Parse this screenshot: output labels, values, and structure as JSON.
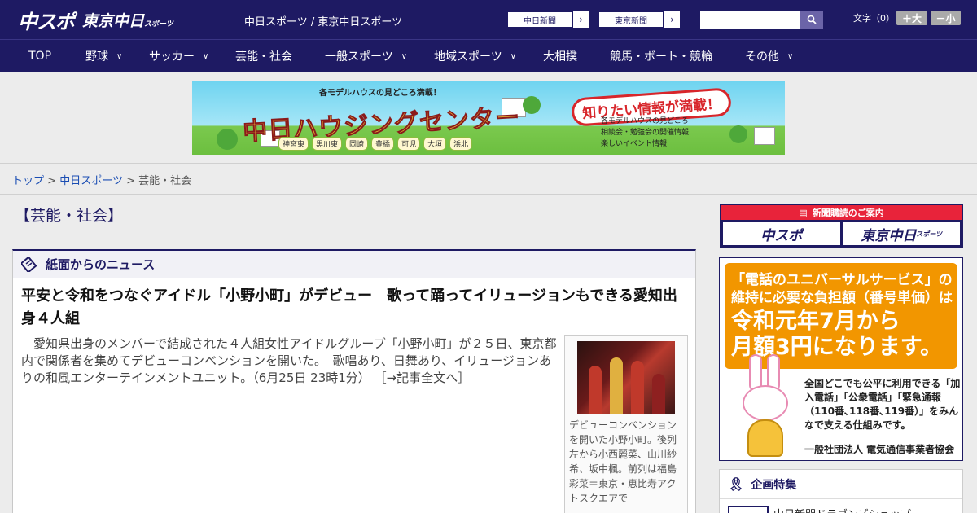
{
  "header": {
    "logo_main": "中スポ",
    "logo_sub": "東京中日",
    "logo_sub_small": "スポーツ",
    "site_names": "中日スポーツ / 東京中日スポーツ",
    "ext_buttons": [
      {
        "label": "中日新聞"
      },
      {
        "label": "東京新聞"
      }
    ],
    "search_placeholder": "",
    "font_size_label": "文字（0）",
    "font_larger": "＋大",
    "font_smaller": "－小"
  },
  "nav": [
    {
      "label": "TOP",
      "dropdown": false
    },
    {
      "label": "野球",
      "dropdown": true
    },
    {
      "label": "サッカー",
      "dropdown": true
    },
    {
      "label": "芸能・社会",
      "dropdown": false
    },
    {
      "label": "一般スポーツ",
      "dropdown": true
    },
    {
      "label": "地域スポーツ",
      "dropdown": true
    },
    {
      "label": "大相撲",
      "dropdown": false
    },
    {
      "label": "競馬・ボート・競輪",
      "dropdown": false
    },
    {
      "label": "その他",
      "dropdown": true
    }
  ],
  "banner": {
    "top_note": "各モデルハウスの見どころ満載！",
    "title": "中日ハウジングセンター",
    "bubble": "知りたい情報が満載！",
    "cities": [
      "神宮東",
      "黒川東",
      "岡崎",
      "豊橋",
      "可児",
      "大垣",
      "浜北"
    ],
    "info": [
      "各モデルハウスの見どころ",
      "相談会・勉強会の開催情報",
      "楽しいイベント情報"
    ]
  },
  "breadcrumb": {
    "top": "トップ",
    "section": "中日スポーツ",
    "current": "芸能・社会",
    "sep": ">"
  },
  "main": {
    "category_title": "【芸能・社会】",
    "news_heading": "紙面からのニュース",
    "article": {
      "title": "平安と令和をつなぐアイドル「小野小町」がデビュー　歌って踊ってイリュージョンもできる愛知出身４人組",
      "body": "　愛知県出身のメンバーで結成された４人組女性アイドルグループ「小野小町」が２５日、東京都内で関係者を集めてデビューコンベンションを開いた。　歌唱あり、日舞あり、イリュージョンありの和風エンターテインメントユニット。（6月25日 23時1分）",
      "more_link": "［→記事全文へ］",
      "caption": "デビューコンベンションを開いた小野小町。後列左から小西麗菜、山川紗希、坂中楓。前列は福島彩菜＝東京・恵比寿アクトスクエアで"
    }
  },
  "sidebar": {
    "subscribe_head": "新聞購読のご案内",
    "subscribe_btn1": "中スポ",
    "subscribe_btn2": "東京中日",
    "subscribe_btn2_small": "スポーツ",
    "universal": {
      "line1": "「電話のユニバーサルサービス」の",
      "line2": "維持に必要な負担額（番号単価）は",
      "big1": "令和元年7月から",
      "big2": "月額3円になります。",
      "desc": "全国どこでも公平に利用できる「加入電話」「公衆電話」「緊急通報（110番､118番､119番）」をみんなで支える仕組みです。",
      "org": "一般社団法人 電気通信事業者協会"
    },
    "kikaku_head": "企画特集",
    "kikaku_item": "中日新聞ドラゴンズショップ"
  },
  "colors": {
    "header_bg": "#1e1a63",
    "link": "#1a4db3",
    "accent_red": "#e8233a",
    "orange": "#f29600"
  }
}
